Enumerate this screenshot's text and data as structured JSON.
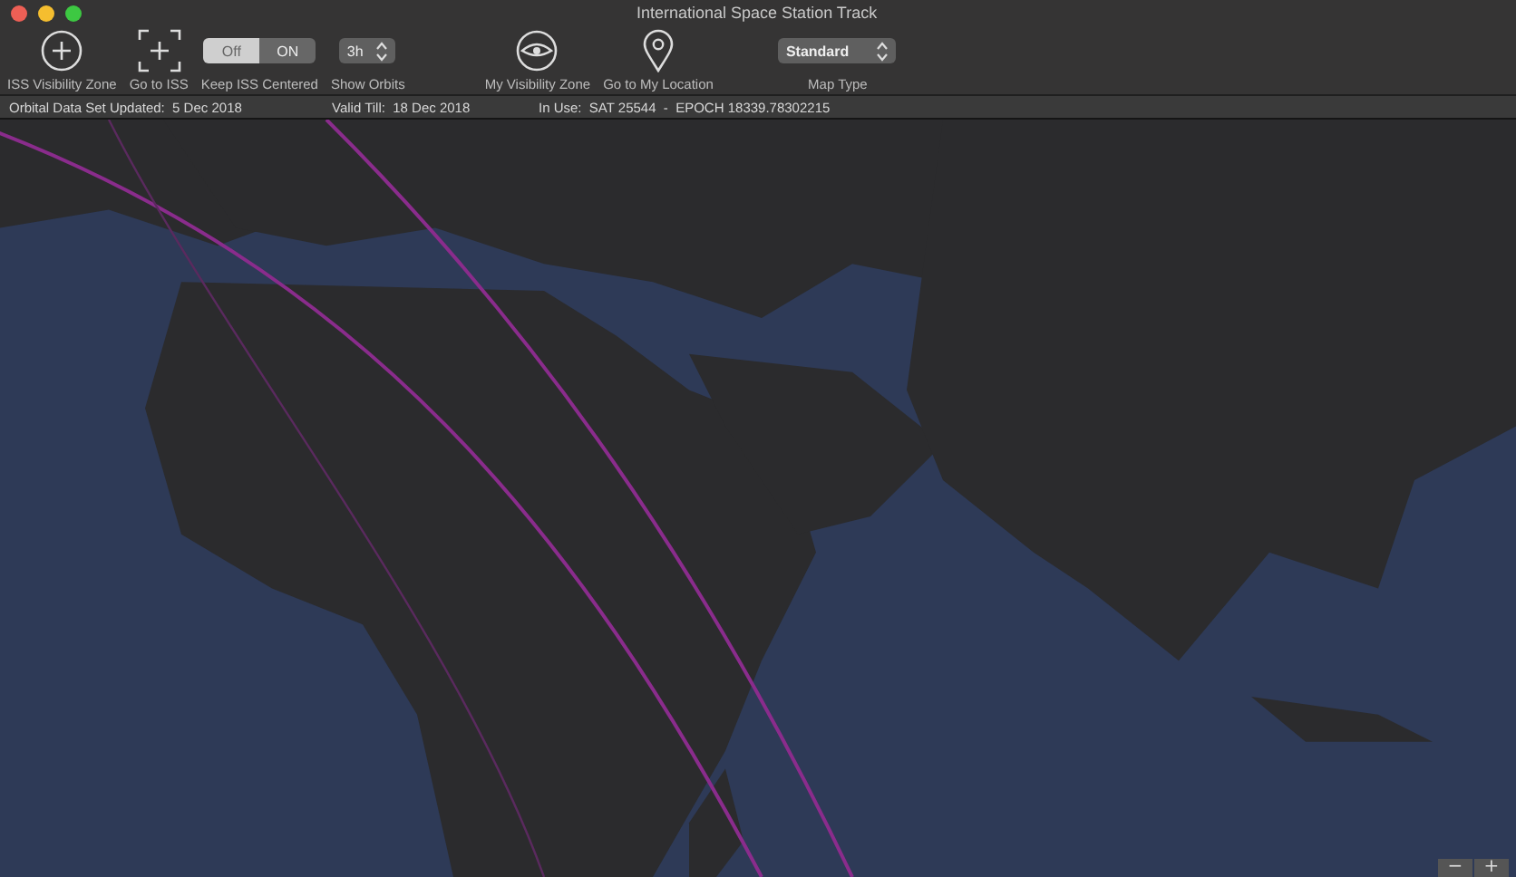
{
  "window": {
    "title": "International Space Station Track"
  },
  "toolbar": {
    "groups": [
      {
        "items": [
          {
            "kind": "circle-plus",
            "label": "ISS Visibility Zone"
          },
          {
            "kind": "frame-plus",
            "label": "Go to ISS"
          },
          {
            "kind": "segmented",
            "label": "Keep ISS Centered",
            "segments": [
              {
                "text": "Off",
                "selected": true
              },
              {
                "text": "ON",
                "selected": false
              }
            ]
          },
          {
            "kind": "stepper",
            "label": "Show Orbits",
            "value": "3h"
          }
        ]
      },
      {
        "items": [
          {
            "kind": "eye",
            "label": "My Visibility Zone"
          },
          {
            "kind": "pin",
            "label": "Go to My Location"
          }
        ]
      },
      {
        "items": [
          {
            "kind": "popup",
            "label": "Map Type",
            "value": "Standard"
          }
        ]
      }
    ]
  },
  "info_bar": [
    "Orbital Data Set Updated:  5 Dec 2018",
    "Valid Till:  18 Dec 2018",
    "In Use:  SAT 25544  -  EPOCH 18339.78302215"
  ],
  "map": {
    "kind": "picture",
    "zoom_controls": [
      "−",
      "+"
    ]
  }
}
